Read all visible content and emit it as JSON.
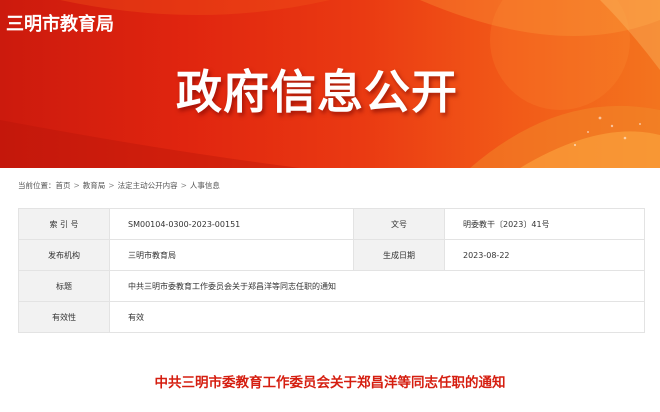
{
  "header": {
    "site_name": "三明市教育局",
    "banner_title": "政府信息公开"
  },
  "breadcrumb": {
    "prefix": "当前位置：",
    "items": [
      "首页",
      "教育局",
      "法定主动公开内容",
      "人事信息"
    ]
  },
  "info_table": {
    "index_label": "索 引 号",
    "index_value": "SM00104-0300-2023-00151",
    "doc_no_label": "文号",
    "doc_no_value": "明委教干〔2023〕41号",
    "publisher_label": "发布机构",
    "publisher_value": "三明市教育局",
    "date_label": "生成日期",
    "date_value": "2023-08-22",
    "title_label": "标题",
    "title_value": "中共三明市委教育工作委员会关于郑昌洋等同志任职的通知",
    "validity_label": "有效性",
    "validity_value": "有效"
  },
  "document": {
    "title": "中共三明市委教育工作委员会关于郑昌洋等同志任职的通知"
  },
  "colors": {
    "banner_red": "#e0250f",
    "title_red": "#d51e10"
  }
}
